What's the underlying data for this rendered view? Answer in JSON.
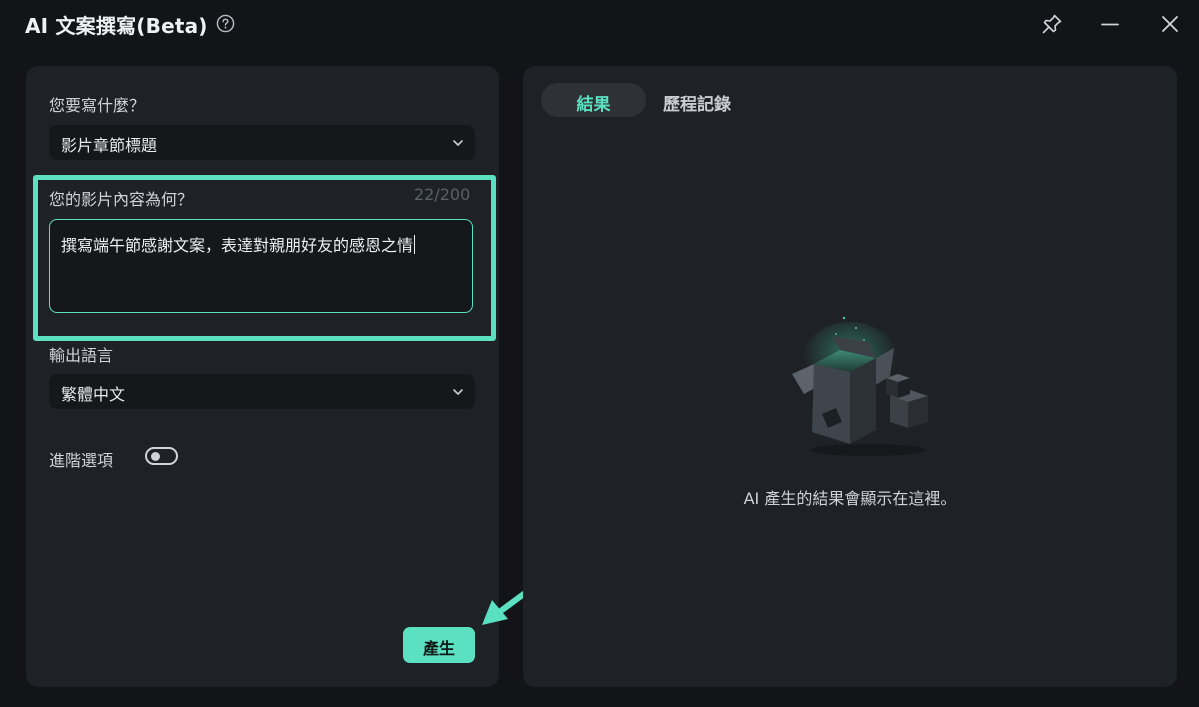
{
  "window": {
    "title": "AI 文案撰寫(Beta)",
    "icons": [
      "help-icon",
      "pin-icon",
      "minimize-icon",
      "close-icon"
    ]
  },
  "form": {
    "what_label": "您要寫什麼？",
    "what_value": "影片章節標題",
    "content_label": "您的影片內容為何？",
    "content_counter": "22/200",
    "content_value": "撰寫端午節感謝文案，表達對親朋好友的感恩之情",
    "language_label": "輸出語言",
    "language_value": "繁體中文",
    "advanced_label": "進階選項",
    "advanced_enabled": false,
    "generate_label": "產生"
  },
  "results": {
    "tabs": [
      {
        "label": "結果",
        "active": true
      },
      {
        "label": "歷程記錄",
        "active": false
      }
    ],
    "empty_message": "AI 產生的結果會顯示在這裡。"
  },
  "colors": {
    "accent": "#5ce0c2",
    "background": "#121417",
    "panel": "#1e2125"
  }
}
